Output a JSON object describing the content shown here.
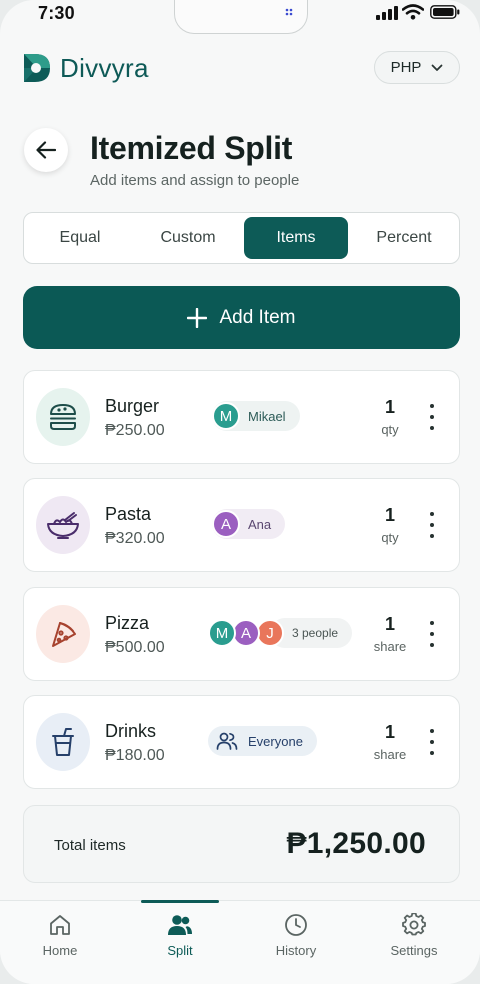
{
  "status_bar": {
    "time": "7:30"
  },
  "brand": {
    "name": "Divvyra",
    "accent": "#0d5b57"
  },
  "currency": {
    "value": "PHP"
  },
  "page": {
    "title": "Itemized Split",
    "subtitle": "Add items and assign to people"
  },
  "split_modes": {
    "selected": "Items",
    "tabs": [
      {
        "label": "Equal"
      },
      {
        "label": "Custom"
      },
      {
        "label": "Items"
      },
      {
        "label": "Percent"
      }
    ]
  },
  "add_item": {
    "label": "Add Item"
  },
  "items": [
    {
      "name": "Burger",
      "price": "₱250.00",
      "icon": "burger-icon",
      "icon_bg": "#e6f3ee",
      "assignees": [
        {
          "initial": "M",
          "color": "#2a9d8f"
        }
      ],
      "assign_label": "Mikael",
      "quantity": "1",
      "unit": "qty"
    },
    {
      "name": "Pasta",
      "price": "₱320.00",
      "icon": "pasta-bowl-icon",
      "icon_bg": "#efe8f3",
      "assignees": [
        {
          "initial": "A",
          "color": "#9b5fc0"
        }
      ],
      "assign_label": "Ana",
      "quantity": "1",
      "unit": "qty"
    },
    {
      "name": "Pizza",
      "price": "₱500.00",
      "icon": "pizza-slice-icon",
      "icon_bg": "#fbe9e4",
      "assignees": [
        {
          "initial": "M",
          "color": "#2a9d8f"
        },
        {
          "initial": "A",
          "color": "#9b5fc0"
        },
        {
          "initial": "J",
          "color": "#e9765b"
        }
      ],
      "assign_label": "3 people",
      "quantity": "1",
      "unit": "share"
    },
    {
      "name": "Drinks",
      "price": "₱180.00",
      "icon": "drink-cup-icon",
      "icon_bg": "#e8eef6",
      "assignees": [],
      "assign_icon": "people-icon",
      "assign_label": "Everyone",
      "quantity": "1",
      "unit": "share"
    }
  ],
  "total": {
    "label": "Total items",
    "amount": "₱1,250.00"
  },
  "bottom_nav": {
    "selected": "Split",
    "items": [
      {
        "label": "Home",
        "icon": "home-icon"
      },
      {
        "label": "Split",
        "icon": "people-icon"
      },
      {
        "label": "History",
        "icon": "clock-icon"
      },
      {
        "label": "Settings",
        "icon": "gear-icon"
      }
    ]
  }
}
